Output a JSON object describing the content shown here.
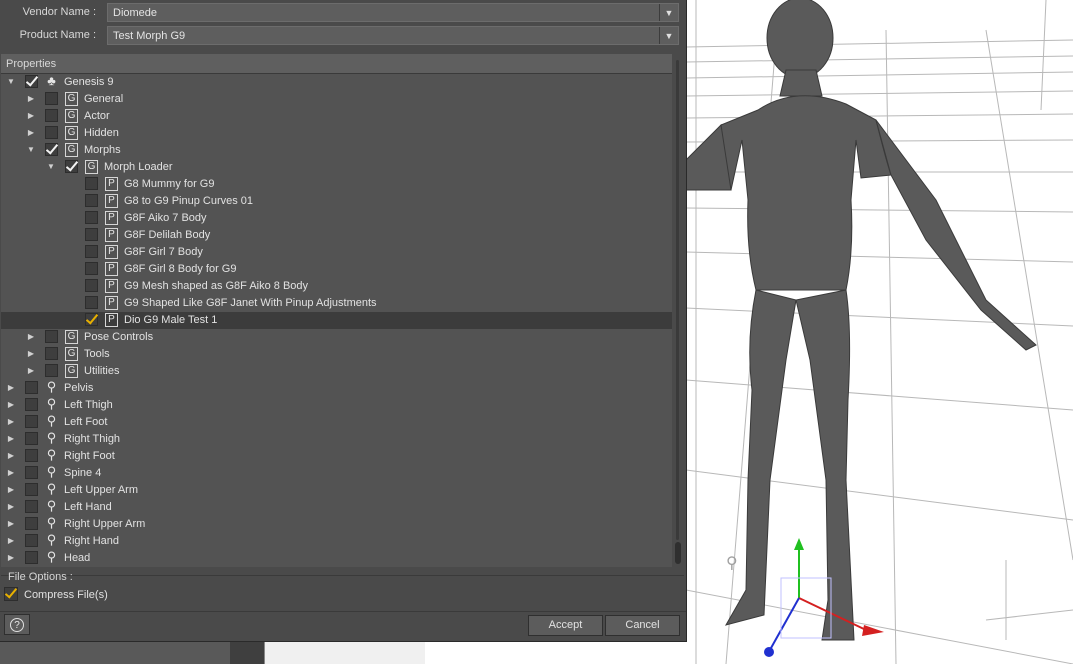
{
  "dialog": {
    "vendor_label": "Vendor Name :",
    "vendor_value": "Diomede",
    "product_label": "Product Name :",
    "product_value": "Test Morph G9",
    "properties_label": "Properties",
    "file_options_label": "File Options :",
    "compress_label": "Compress File(s)",
    "compress_checked": true,
    "help_label": "?",
    "accept_label": "Accept",
    "cancel_label": "Cancel"
  },
  "tree": [
    {
      "label": "Genesis 9",
      "icon": "figure-icon",
      "level": 0,
      "expand": "open",
      "checked": true
    },
    {
      "label": "General",
      "icon": "group-icon",
      "level": 1,
      "expand": "closed",
      "checked": false
    },
    {
      "label": "Actor",
      "icon": "group-icon",
      "level": 1,
      "expand": "closed",
      "checked": false
    },
    {
      "label": "Hidden",
      "icon": "group-icon",
      "level": 1,
      "expand": "closed",
      "checked": false
    },
    {
      "label": "Morphs",
      "icon": "group-icon",
      "level": 1,
      "expand": "open",
      "checked": true
    },
    {
      "label": "Morph Loader",
      "icon": "group-icon",
      "level": 2,
      "expand": "open",
      "checked": true
    },
    {
      "label": "G8 Mummy for G9",
      "icon": "property-icon",
      "level": 3,
      "expand": "none",
      "checked": false
    },
    {
      "label": "G8 to G9 Pinup Curves 01",
      "icon": "property-icon",
      "level": 3,
      "expand": "none",
      "checked": false
    },
    {
      "label": "G8F Aiko 7 Body",
      "icon": "property-icon",
      "level": 3,
      "expand": "none",
      "checked": false
    },
    {
      "label": "G8F Delilah Body",
      "icon": "property-icon",
      "level": 3,
      "expand": "none",
      "checked": false
    },
    {
      "label": "G8F Girl 7 Body",
      "icon": "property-icon",
      "level": 3,
      "expand": "none",
      "checked": false
    },
    {
      "label": "G8F Girl 8 Body for G9",
      "icon": "property-icon",
      "level": 3,
      "expand": "none",
      "checked": false
    },
    {
      "label": "G9 Mesh shaped as G8F Aiko 8 Body",
      "icon": "property-icon",
      "level": 3,
      "expand": "none",
      "checked": false
    },
    {
      "label": "G9 Shaped Like G8F Janet With Pinup Adjustments",
      "icon": "property-icon",
      "level": 3,
      "expand": "none",
      "checked": false
    },
    {
      "label": "Dio G9 Male Test 1",
      "icon": "property-icon",
      "level": 3,
      "expand": "none",
      "checked": true,
      "selected": true
    },
    {
      "label": "Pose Controls",
      "icon": "group-icon",
      "level": 1,
      "expand": "closed",
      "checked": false
    },
    {
      "label": "Tools",
      "icon": "group-icon",
      "level": 1,
      "expand": "closed",
      "checked": false
    },
    {
      "label": "Utilities",
      "icon": "group-icon",
      "level": 1,
      "expand": "closed",
      "checked": false
    },
    {
      "label": "Pelvis",
      "icon": "bone-icon",
      "level": 0,
      "expand": "closed",
      "checked": false
    },
    {
      "label": "Left Thigh",
      "icon": "bone-icon",
      "level": 0,
      "expand": "closed",
      "checked": false
    },
    {
      "label": "Left Foot",
      "icon": "bone-icon",
      "level": 0,
      "expand": "closed",
      "checked": false
    },
    {
      "label": "Right Thigh",
      "icon": "bone-icon",
      "level": 0,
      "expand": "closed",
      "checked": false
    },
    {
      "label": "Right Foot",
      "icon": "bone-icon",
      "level": 0,
      "expand": "closed",
      "checked": false
    },
    {
      "label": "Spine 4",
      "icon": "bone-icon",
      "level": 0,
      "expand": "closed",
      "checked": false
    },
    {
      "label": "Left Upper Arm",
      "icon": "bone-icon",
      "level": 0,
      "expand": "closed",
      "checked": false
    },
    {
      "label": "Left Hand",
      "icon": "bone-icon",
      "level": 0,
      "expand": "closed",
      "checked": false
    },
    {
      "label": "Right Upper Arm",
      "icon": "bone-icon",
      "level": 0,
      "expand": "closed",
      "checked": false
    },
    {
      "label": "Right Hand",
      "icon": "bone-icon",
      "level": 0,
      "expand": "closed",
      "checked": false
    },
    {
      "label": "Head",
      "icon": "bone-icon",
      "level": 0,
      "expand": "closed",
      "checked": false
    }
  ],
  "colors": {
    "dialog_bg": "#4a4a4a",
    "tree_bg": "#535353",
    "selected_row": "#3c3c3c",
    "accent_check": "#e8b000",
    "axis_x": "#d42020",
    "axis_y": "#20c020",
    "axis_z": "#2030d0"
  }
}
